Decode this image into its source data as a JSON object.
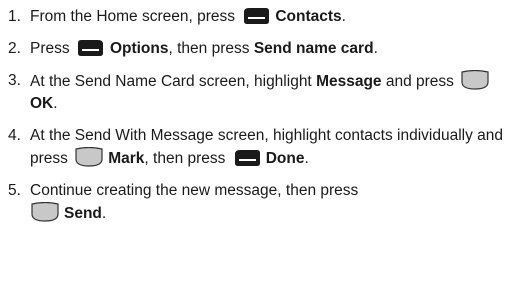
{
  "steps": [
    {
      "num": "1.",
      "t1": "From the Home screen, press",
      "icon": "left-softkey-icon",
      "b1": "Contacts",
      "t2": "."
    },
    {
      "num": "2.",
      "t1": "Press",
      "icon": "right-softkey-icon",
      "b1": "Options",
      "t2": ", then press",
      "b2": "Send name card",
      "t3": "."
    },
    {
      "num": "3.",
      "t1": "At the Send Name Card screen, highlight",
      "b1": "Message",
      "t2": "and press",
      "icon": "ok-key-icon",
      "b2": "OK",
      "t3": "."
    },
    {
      "num": "4.",
      "t1": "At the Send With Message screen, highlight contacts individually and press",
      "icon": "ok-key-icon",
      "b1": "Mark",
      "t2": ", then press",
      "icon2": "left-softkey-icon",
      "b2": "Done",
      "t3": "."
    },
    {
      "num": "5.",
      "t1": "Continue creating the new message, then press",
      "icon": "ok-key-icon",
      "b1": "Send",
      "t2": "."
    }
  ]
}
